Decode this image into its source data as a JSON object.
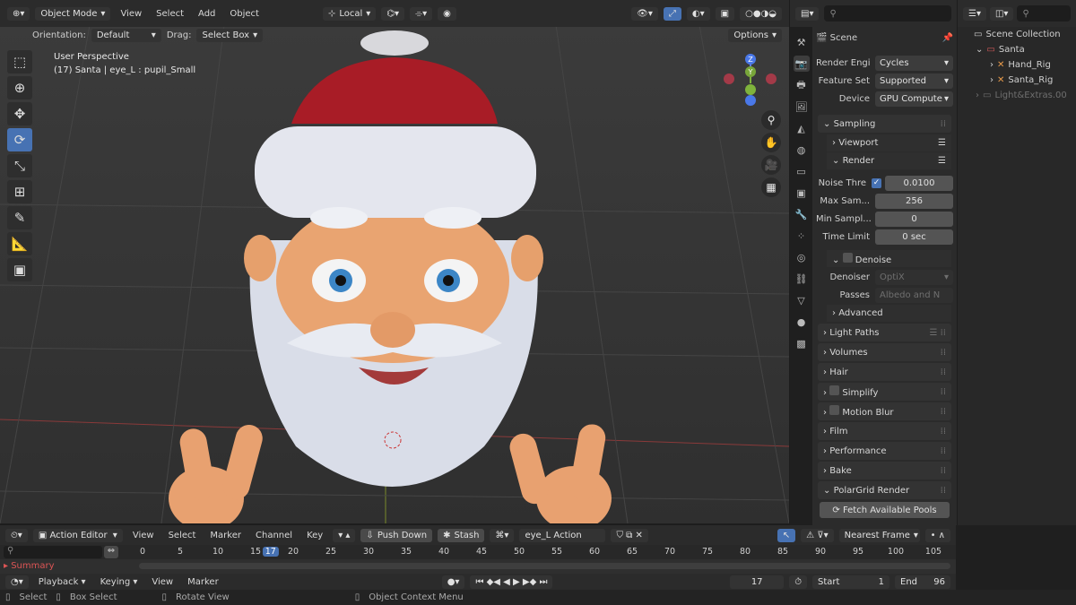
{
  "viewport": {
    "mode": "Object Mode",
    "menus": [
      "View",
      "Select",
      "Add",
      "Object"
    ],
    "transform_orientation": "Local",
    "orientation_label": "Orientation:",
    "orientation_value": "Default",
    "drag_label": "Drag:",
    "drag_value": "Select Box",
    "options_label": "Options",
    "perspective": "User Perspective",
    "context": "(17) Santa | eye_L : pupil_Small",
    "gizmo_axes": {
      "z": "Z",
      "y": "Y"
    },
    "tools": [
      "select-box",
      "cursor",
      "move",
      "rotate",
      "scale",
      "transform",
      "annotate",
      "measure",
      "add-cube"
    ]
  },
  "properties": {
    "scene_label": "Scene",
    "render_engine": {
      "label": "Render Engi",
      "value": "Cycles"
    },
    "feature_set": {
      "label": "Feature Set",
      "value": "Supported"
    },
    "device": {
      "label": "Device",
      "value": "GPU Compute"
    },
    "sampling": "Sampling",
    "viewport": "Viewport",
    "render": "Render",
    "noise_threshold": {
      "label": "Noise Thre",
      "value": "0.0100"
    },
    "max_samples": {
      "label": "Max Sam...",
      "value": "256"
    },
    "min_samples": {
      "label": "Min Sampl...",
      "value": "0"
    },
    "time_limit": {
      "label": "Time Limit",
      "value": "0 sec"
    },
    "denoise": "Denoise",
    "denoiser": {
      "label": "Denoiser",
      "value": "OptiX"
    },
    "passes": {
      "label": "Passes",
      "value": "Albedo and N"
    },
    "advanced": "Advanced",
    "panels": [
      "Light Paths",
      "Volumes",
      "Hair",
      "Simplify",
      "Motion Blur",
      "Film",
      "Performance",
      "Bake",
      "PolarGrid Render"
    ],
    "fetch_button": "Fetch Available Pools"
  },
  "outliner": {
    "root": "Scene Collection",
    "items": [
      {
        "label": "Santa",
        "level": 1
      },
      {
        "label": "Hand_Rig",
        "level": 2
      },
      {
        "label": "Santa_Rig",
        "level": 2
      },
      {
        "label": "Light&Extras.00",
        "level": 1
      }
    ]
  },
  "timeline": {
    "editor": "Action Editor",
    "menus": [
      "View",
      "Select",
      "Marker",
      "Channel",
      "Key"
    ],
    "push_down": "Push Down",
    "stash": "Stash",
    "action": "eye_L Action",
    "interpolation": "Nearest Frame",
    "ticks": [
      "0",
      "5",
      "10",
      "15",
      "17",
      "20",
      "25",
      "30",
      "35",
      "40",
      "45",
      "50",
      "55",
      "60",
      "65",
      "70",
      "75",
      "80",
      "85",
      "90",
      "95",
      "100",
      "105"
    ],
    "current_frame": "17",
    "summary": "Summary",
    "playback_menus": [
      "Playback",
      "Keying",
      "View",
      "Marker"
    ],
    "frame_field": "17",
    "start_label": "Start",
    "start_value": "1",
    "end_label": "End",
    "end_value": "96"
  },
  "statusbar": {
    "select": "Select",
    "box_select": "Box Select",
    "rotate_view": "Rotate View",
    "context_menu": "Object Context Menu"
  }
}
